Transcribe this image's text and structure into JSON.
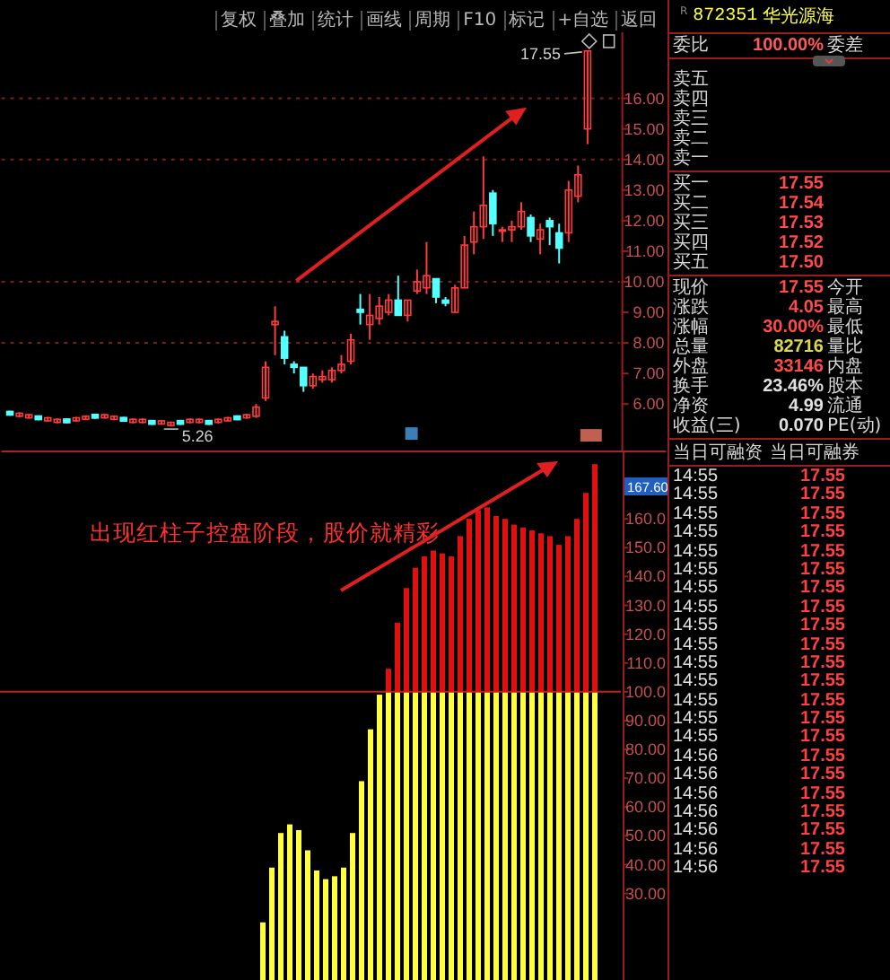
{
  "toolbar": {
    "buttons": [
      "复权",
      "叠加",
      "统计",
      "画线",
      "周期",
      "F10",
      "标记",
      "+自选",
      "返回"
    ]
  },
  "quote_header": {
    "prefix": "R",
    "code": "872351",
    "name": "华光源海"
  },
  "order_ratio": {
    "label": "委比",
    "value": "100.00%",
    "label_2": "委差"
  },
  "asks": [
    "卖五",
    "卖四",
    "卖三",
    "卖二",
    "卖一"
  ],
  "bids": [
    {
      "label": "买一",
      "price": "17.55"
    },
    {
      "label": "买二",
      "price": "17.54"
    },
    {
      "label": "买三",
      "price": "17.53"
    },
    {
      "label": "买四",
      "price": "17.52"
    },
    {
      "label": "买五",
      "price": "17.50"
    }
  ],
  "stats": [
    {
      "label": "现价",
      "value": "17.55",
      "label_2": "今开",
      "color": "#ff4a4a"
    },
    {
      "label": "涨跌",
      "value": "4.05",
      "label_2": "最高",
      "color": "#ff4a4a"
    },
    {
      "label": "涨幅",
      "value": "30.00%",
      "label_2": "最低",
      "color": "#ff4a4a"
    },
    {
      "label": "总量",
      "value": "82716",
      "label_2": "量比",
      "color": "#d8d84a"
    },
    {
      "label": "外盘",
      "value": "33146",
      "label_2": "内盘",
      "color": "#ff4a4a"
    },
    {
      "label": "换手",
      "value": "23.46%",
      "label_2": "股本",
      "color": "#e0e0e0"
    },
    {
      "label": "净资",
      "value": "4.99",
      "label_2": "流通",
      "color": "#e0e0e0"
    },
    {
      "label": "收益(三)",
      "value": "0.070",
      "label_2": "PE(动)",
      "color": "#e0e0e0"
    }
  ],
  "margin_header": [
    "当日可融资",
    "当日可融券"
  ],
  "ticks": [
    {
      "time": "14:55",
      "price": "17.55"
    },
    {
      "time": "14:55",
      "price": "17.55"
    },
    {
      "time": "14:55",
      "price": "17.55"
    },
    {
      "time": "14:55",
      "price": "17.55"
    },
    {
      "time": "14:55",
      "price": "17.55"
    },
    {
      "time": "14:55",
      "price": "17.55"
    },
    {
      "time": "14:55",
      "price": "17.55"
    },
    {
      "time": "14:55",
      "price": "17.55"
    },
    {
      "time": "14:55",
      "price": "17.55"
    },
    {
      "time": "14:55",
      "price": "17.55"
    },
    {
      "time": "14:55",
      "price": "17.55"
    },
    {
      "time": "14:55",
      "price": "17.55"
    },
    {
      "time": "14:55",
      "price": "17.55"
    },
    {
      "time": "14:55",
      "price": "17.55"
    },
    {
      "time": "14:55",
      "price": "17.55"
    },
    {
      "time": "14:56",
      "price": "17.55"
    },
    {
      "time": "14:56",
      "price": "17.55"
    },
    {
      "time": "14:56",
      "price": "17.55"
    },
    {
      "time": "14:56",
      "price": "17.55"
    },
    {
      "time": "14:56",
      "price": "17.55"
    },
    {
      "time": "14:56",
      "price": "17.55"
    },
    {
      "time": "14:56",
      "price": "17.55"
    }
  ],
  "upper_chart": {
    "high_label": "17.55",
    "low_label": "5.26",
    "chart_data": {
      "type": "candlestick",
      "ylim": [
        4.48,
        18.16
      ],
      "grid": true,
      "ohlc": [
        [
          5.76,
          5.78,
          5.62,
          5.64
        ],
        [
          5.6,
          5.73,
          5.57,
          5.7
        ],
        [
          5.55,
          5.68,
          5.52,
          5.65
        ],
        [
          5.61,
          5.63,
          5.47,
          5.49
        ],
        [
          5.45,
          5.58,
          5.42,
          5.55
        ],
        [
          5.4,
          5.53,
          5.37,
          5.5
        ],
        [
          5.51,
          5.53,
          5.37,
          5.39
        ],
        [
          5.45,
          5.58,
          5.42,
          5.55
        ],
        [
          5.5,
          5.63,
          5.47,
          5.6
        ],
        [
          5.66,
          5.68,
          5.52,
          5.54
        ],
        [
          5.55,
          5.68,
          5.52,
          5.65
        ],
        [
          5.5,
          5.63,
          5.47,
          5.6
        ],
        [
          5.56,
          5.58,
          5.42,
          5.44
        ],
        [
          5.4,
          5.53,
          5.37,
          5.5
        ],
        [
          5.4,
          5.53,
          5.37,
          5.5
        ],
        [
          5.46,
          5.48,
          5.32,
          5.34
        ],
        [
          5.35,
          5.48,
          5.32,
          5.45
        ],
        [
          5.3,
          5.43,
          5.26,
          5.4
        ],
        [
          5.46,
          5.48,
          5.32,
          5.34
        ],
        [
          5.4,
          5.53,
          5.37,
          5.5
        ],
        [
          5.4,
          5.53,
          5.37,
          5.5
        ],
        [
          5.46,
          5.48,
          5.32,
          5.34
        ],
        [
          5.4,
          5.53,
          5.37,
          5.5
        ],
        [
          5.45,
          5.58,
          5.42,
          5.55
        ],
        [
          5.61,
          5.63,
          5.47,
          5.49
        ],
        [
          5.55,
          5.68,
          5.52,
          5.65
        ],
        [
          5.6,
          6.0,
          5.55,
          5.9
        ],
        [
          6.2,
          7.4,
          6.1,
          7.2
        ],
        [
          8.6,
          9.2,
          7.6,
          8.7
        ],
        [
          8.2,
          8.4,
          7.3,
          7.5
        ],
        [
          7.3,
          7.4,
          7.0,
          7.2
        ],
        [
          7.2,
          7.2,
          6.4,
          6.6
        ],
        [
          6.6,
          7.0,
          6.5,
          6.9
        ],
        [
          6.8,
          7.1,
          6.7,
          6.9
        ],
        [
          6.8,
          7.2,
          6.7,
          7.1
        ],
        [
          7.1,
          7.6,
          7.0,
          7.3
        ],
        [
          7.4,
          8.3,
          7.3,
          8.1
        ],
        [
          9.1,
          9.6,
          8.6,
          9.0
        ],
        [
          8.6,
          9.6,
          8.1,
          8.9
        ],
        [
          8.8,
          9.5,
          8.6,
          9.2
        ],
        [
          9.0,
          9.6,
          8.9,
          9.4
        ],
        [
          9.4,
          10.2,
          8.9,
          8.9
        ],
        [
          8.9,
          9.4,
          8.7,
          9.4
        ],
        [
          9.7,
          10.4,
          9.6,
          10.0
        ],
        [
          9.8,
          11.3,
          9.6,
          10.2
        ],
        [
          10.1,
          10.1,
          9.3,
          9.5
        ],
        [
          9.4,
          9.5,
          9.2,
          9.3
        ],
        [
          9.0,
          9.9,
          9.0,
          9.8
        ],
        [
          9.8,
          11.5,
          9.8,
          11.2
        ],
        [
          11.3,
          12.3,
          10.9,
          11.8
        ],
        [
          11.8,
          14.1,
          11.4,
          12.5
        ],
        [
          12.9,
          13.0,
          11.5,
          11.9
        ],
        [
          11.7,
          11.8,
          11.3,
          11.7
        ],
        [
          11.7,
          12.0,
          11.3,
          11.8
        ],
        [
          11.8,
          12.6,
          11.7,
          12.3
        ],
        [
          12.1,
          12.2,
          11.3,
          11.5
        ],
        [
          11.4,
          11.9,
          10.9,
          11.7
        ],
        [
          12.0,
          12.1,
          11.2,
          11.8
        ],
        [
          11.6,
          11.9,
          10.6,
          11.1
        ],
        [
          11.6,
          13.3,
          11.3,
          13.0
        ],
        [
          12.8,
          13.8,
          12.6,
          13.5
        ],
        [
          15.0,
          17.55,
          14.5,
          17.55
        ]
      ],
      "yticks": [
        {
          "value": 16,
          "label": "16.00"
        },
        {
          "value": 15,
          "label": "15.00"
        },
        {
          "value": 14,
          "label": "14.00"
        },
        {
          "value": 13,
          "label": "13.00"
        },
        {
          "value": 12,
          "label": "12.00"
        },
        {
          "value": 11,
          "label": "11.00"
        },
        {
          "value": 10,
          "label": "10.00"
        },
        {
          "value": 9,
          "label": "9.00"
        },
        {
          "value": 8,
          "label": "8.00"
        },
        {
          "value": 7,
          "label": "7.00"
        },
        {
          "value": 6,
          "label": "6.00"
        }
      ]
    }
  },
  "lower_chart": {
    "value_badge": "167.60",
    "annotation": "出现红柱子控盘阶段，股价就精彩",
    "chart_data": {
      "type": "bar",
      "stacked": true,
      "ylim": [
        0,
        183.1
      ],
      "ref_lines": [
        {
          "axis": "y",
          "value": 100,
          "color": "#c02020"
        }
      ],
      "series": [
        {
          "color": "#ffff40",
          "values": [
            20,
            39,
            51,
            54,
            52,
            45,
            38,
            35,
            36,
            39,
            51,
            69,
            87,
            99,
            100,
            100,
            100,
            100,
            100,
            100,
            100,
            100,
            100,
            100,
            100,
            100,
            100,
            100,
            100,
            100,
            100,
            100,
            100,
            100,
            100,
            100,
            100,
            100
          ]
        },
        {
          "color": "#e01010",
          "values": [
            0,
            0,
            0,
            0,
            0,
            0,
            0,
            0,
            0,
            0,
            0,
            0,
            0,
            0,
            8,
            24,
            36,
            43,
            47,
            49,
            48,
            47,
            54,
            60,
            63,
            64,
            61,
            60,
            58,
            57,
            56,
            55,
            54,
            51,
            54,
            60,
            69,
            79
          ]
        }
      ],
      "yticks": [
        {
          "value": 160,
          "label": "160.0"
        },
        {
          "value": 150,
          "label": "150.0"
        },
        {
          "value": 140,
          "label": "140.0"
        },
        {
          "value": 130,
          "label": "130.0"
        },
        {
          "value": 120,
          "label": "120.0"
        },
        {
          "value": 110,
          "label": "110.0"
        },
        {
          "value": 100,
          "label": "100.0"
        },
        {
          "value": 90,
          "label": "90.00"
        },
        {
          "value": 80,
          "label": "80.00"
        },
        {
          "value": 70,
          "label": "70.00"
        },
        {
          "value": 60,
          "label": "60.00"
        },
        {
          "value": 50,
          "label": "50.00"
        },
        {
          "value": 40,
          "label": "40.00"
        },
        {
          "value": 30,
          "label": "30.00"
        }
      ]
    }
  }
}
